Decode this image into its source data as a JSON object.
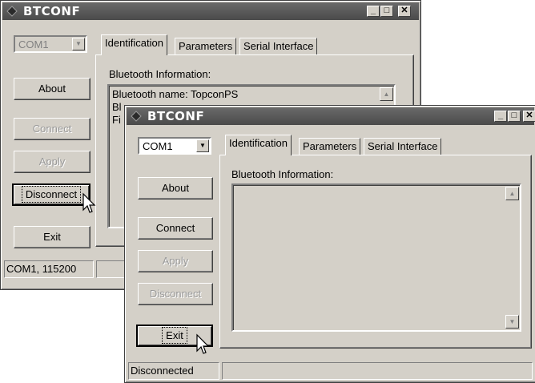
{
  "back_window": {
    "title": "BTCONF",
    "port_combo_value": "COM1",
    "buttons": {
      "about": "About",
      "connect": "Connect",
      "apply": "Apply",
      "disconnect": "Disconnect",
      "exit": "Exit"
    },
    "tabs": [
      "Identification",
      "Parameters",
      "Serial Interface"
    ],
    "group_label": "Bluetooth Information:",
    "info_lines": [
      "Bluetooth name: TopconPS",
      "Bl",
      "Fi"
    ],
    "status_left": "COM1, 115200"
  },
  "front_window": {
    "title": "BTCONF",
    "port_combo_value": "COM1",
    "buttons": {
      "about": "About",
      "connect": "Connect",
      "apply": "Apply",
      "disconnect": "Disconnect",
      "exit": "Exit"
    },
    "tabs": [
      "Identification",
      "Parameters",
      "Serial Interface"
    ],
    "group_label": "Bluetooth Information:",
    "status_left": "Disconnected"
  },
  "glyphs": {
    "scroll_up": "▲",
    "scroll_down": "▼",
    "combo_arrow": "▼",
    "minimize": "_",
    "maximize": "□",
    "close": "✕"
  }
}
